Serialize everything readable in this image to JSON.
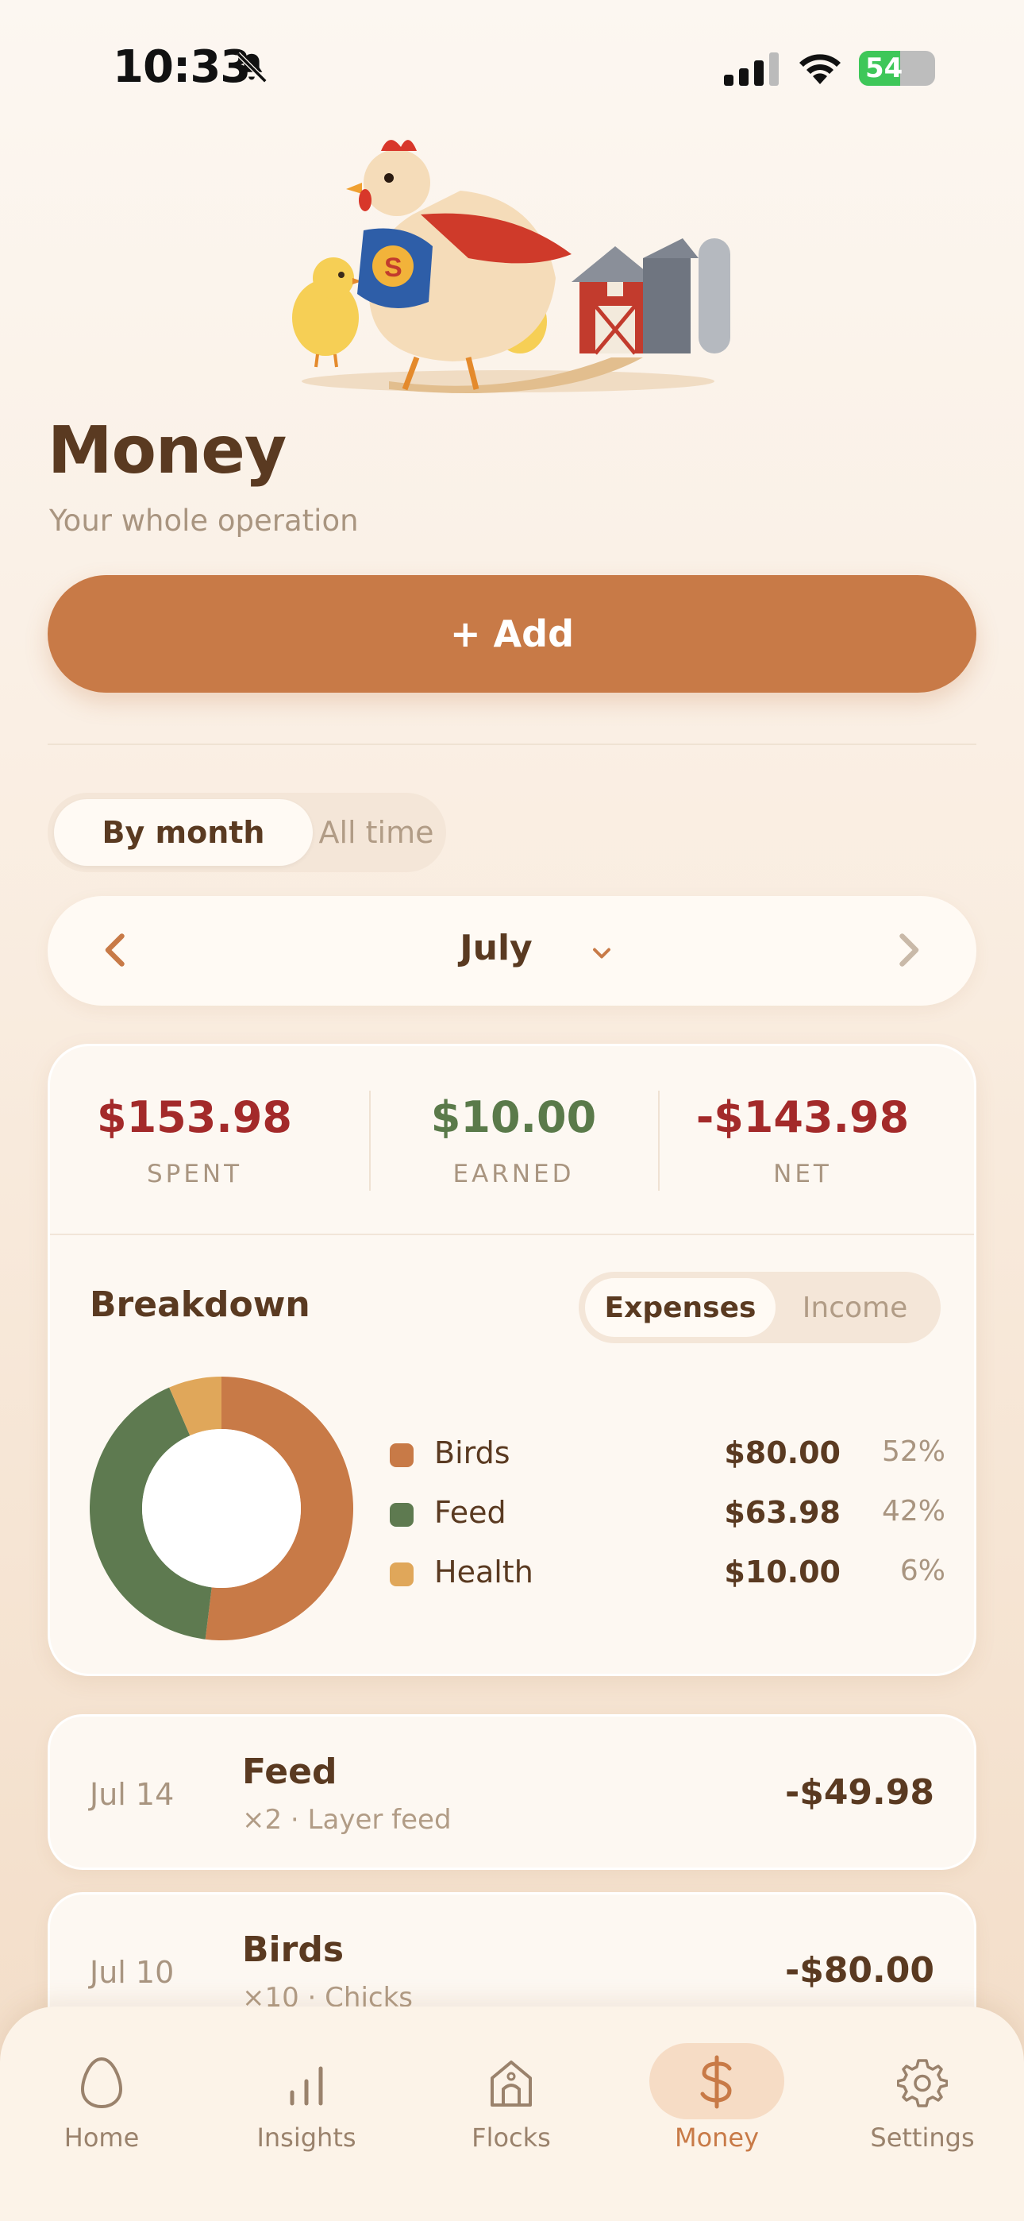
{
  "status_bar": {
    "time": "10:33",
    "battery": "54",
    "battery_level": 0.54
  },
  "header": {
    "title": "Money",
    "subtitle": "Your whole operation"
  },
  "actions": {
    "add_label": "+ Add"
  },
  "view_toggle": {
    "options": [
      "By month",
      "All time"
    ],
    "selected": "By month"
  },
  "month_nav": {
    "month": "July"
  },
  "summary": {
    "spent": {
      "value": "$153.98",
      "label": "SPENT",
      "color": "#a32a2a"
    },
    "earned": {
      "value": "$10.00",
      "label": "EARNED",
      "color": "#5a7a4a"
    },
    "net": {
      "value": "-$143.98",
      "label": "NET",
      "color": "#a32a2a"
    }
  },
  "breakdown": {
    "title": "Breakdown",
    "toggle": [
      "Expenses",
      "Income"
    ],
    "selected": "Expenses",
    "items": [
      {
        "name": "Birds",
        "value": "$80.00",
        "pct": "52%",
        "color": "#c87a47"
      },
      {
        "name": "Feed",
        "value": "$63.98",
        "pct": "42%",
        "color": "#5e7a50"
      },
      {
        "name": "Health",
        "value": "$10.00",
        "pct": "6%",
        "color": "#e0a75a"
      }
    ]
  },
  "chart_data": {
    "type": "pie",
    "categories": [
      "Birds",
      "Feed",
      "Health"
    ],
    "values": [
      80.0,
      63.98,
      10.0
    ],
    "percent": [
      52,
      42,
      6
    ],
    "colors": [
      "#c87a47",
      "#5e7a50",
      "#e0a75a"
    ]
  },
  "transactions": [
    {
      "date": "Jul 14",
      "title": "Feed",
      "subtitle": "×2 · Layer feed",
      "amount": "-$49.98"
    },
    {
      "date": "Jul 10",
      "title": "Birds",
      "subtitle": "×10 · Chicks",
      "amount": "-$80.00"
    }
  ],
  "tabs": [
    {
      "label": "Home",
      "icon": "egg-icon"
    },
    {
      "label": "Insights",
      "icon": "bar-chart-icon"
    },
    {
      "label": "Flocks",
      "icon": "coop-icon"
    },
    {
      "label": "Money",
      "icon": "dollar-icon",
      "active": true
    },
    {
      "label": "Settings",
      "icon": "gear-icon"
    }
  ]
}
